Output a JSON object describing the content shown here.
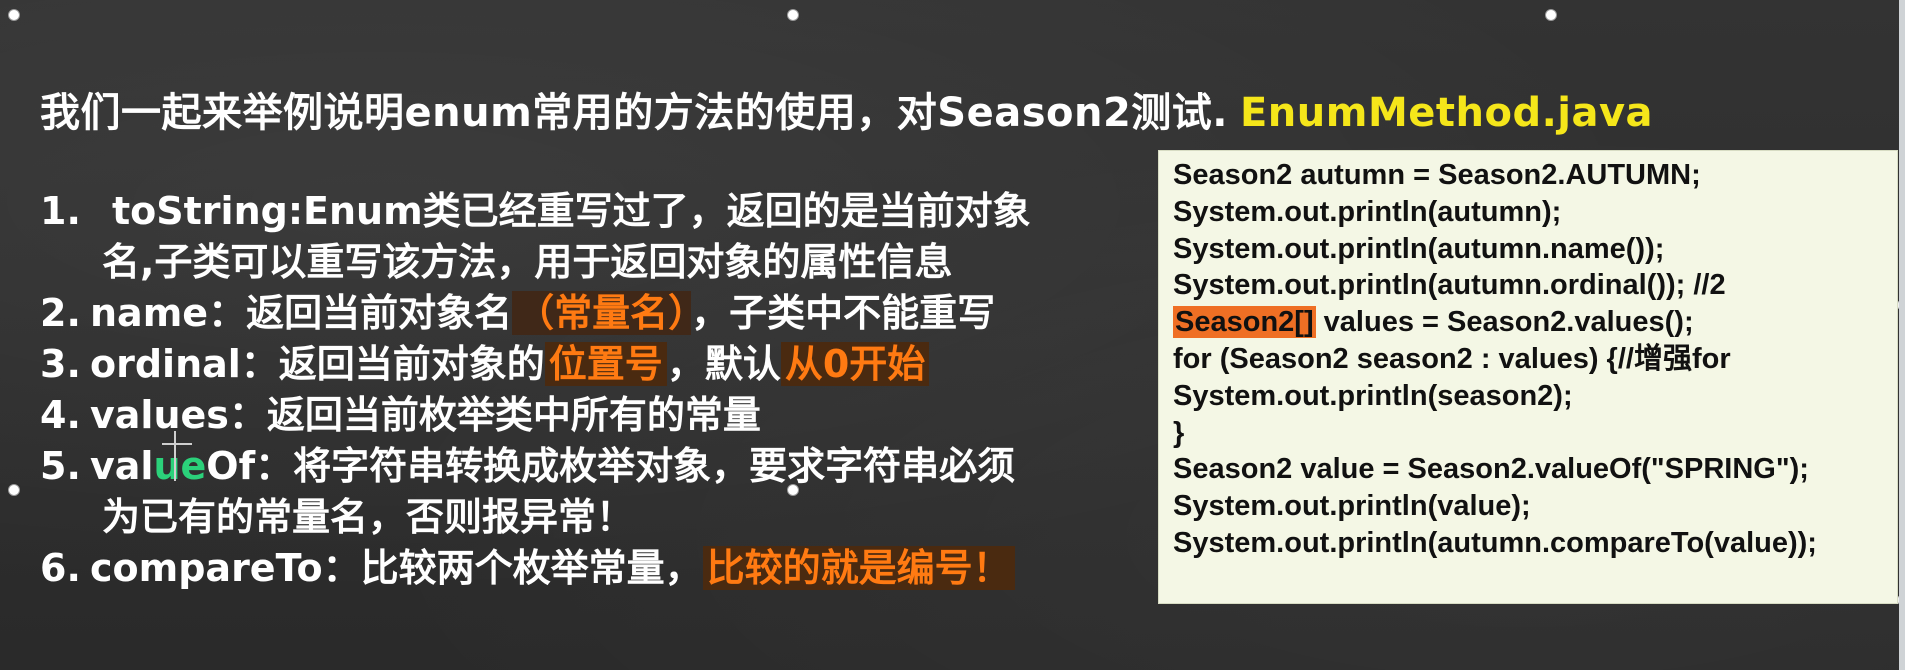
{
  "title": {
    "main": "我们一起来举例说明enum常用的方法的使用，对Season2测试.",
    "file": "EnumMethod.java"
  },
  "items": [
    {
      "num": "1.",
      "segments": [
        {
          "text": "toString:Enum类已经重写过了，返回的是当前对象"
        }
      ],
      "continuation": "名,子类可以重写该方法，用于返回对象的属性信息"
    },
    {
      "num": "2.",
      "segments": [
        {
          "text": "name：返回当前对象名"
        },
        {
          "text": "（常量名）",
          "style": "orange"
        },
        {
          "text": "，子类中不能重写"
        }
      ]
    },
    {
      "num": "3.",
      "segments": [
        {
          "text": "ordinal：返回当前对象的"
        },
        {
          "text": "位置号",
          "style": "orange"
        },
        {
          "text": "，默认"
        },
        {
          "text": "从0开始",
          "style": "orange"
        }
      ]
    },
    {
      "num": "4.",
      "segments": [
        {
          "text": "values：返回当前枚举类中所有的常量"
        }
      ]
    },
    {
      "num": "5.",
      "segments": [
        {
          "text": "val"
        },
        {
          "text": "ue",
          "style": "cursor"
        },
        {
          "text": "Of：将字符串转换成枚举对象，要求字符串必须"
        }
      ],
      "continuation": "为已有的常量名，否则报异常！"
    },
    {
      "num": "6.",
      "segments": [
        {
          "text": "compareTo：比较两个枚举常量，"
        },
        {
          "text": "比较的就是编号！",
          "style": "orange"
        }
      ]
    }
  ],
  "code": [
    {
      "text": "Season2 autumn = Season2.AUTUMN;"
    },
    {
      "text": "System.out.println(autumn);"
    },
    {
      "text": "System.out.println(autumn.name());"
    },
    {
      "text": "System.out.println(autumn.ordinal()); //2"
    },
    {
      "highlight": "Season2[]",
      "text": " values = Season2.values();"
    },
    {
      "text": "for (Season2 season2 : values) {//增强for"
    },
    {
      "text": "System.out.println(season2);"
    },
    {
      "text": "}"
    },
    {
      "text": "Season2 value = Season2.valueOf(\"SPRING\");"
    },
    {
      "text": "System.out.println(value);"
    },
    {
      "text": "System.out.println(autumn.compareTo(value));"
    }
  ],
  "colors": {
    "background": "#2e2e2e",
    "text": "#ffffff",
    "accent_yellow": "#f5e61a",
    "accent_orange": "#ff7a12",
    "code_bg": "#f4f7e5",
    "code_highlight": "#ef6f24"
  }
}
